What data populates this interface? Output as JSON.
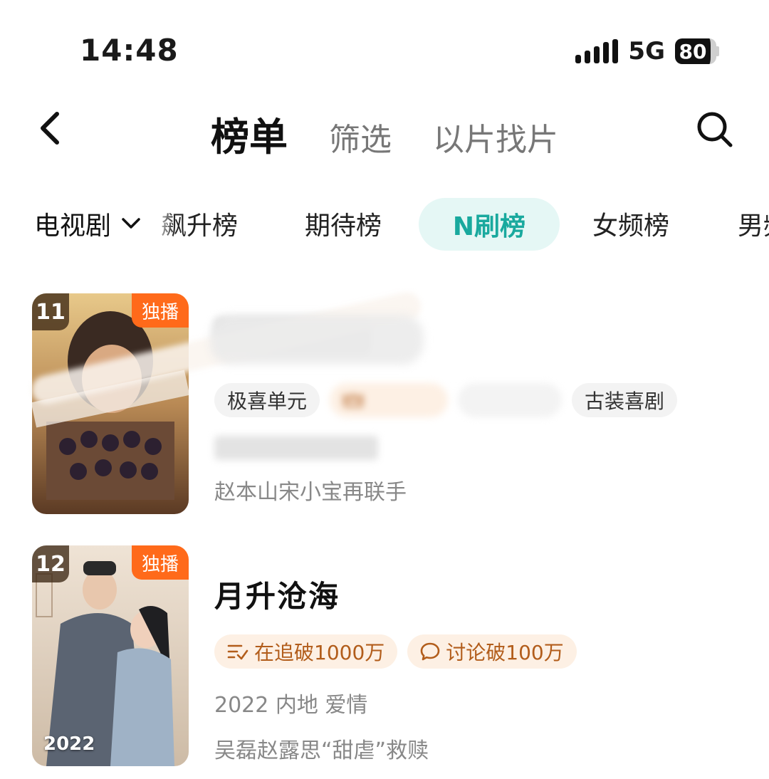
{
  "status_bar": {
    "time": "14:48",
    "network": "5G",
    "battery": "80"
  },
  "nav": {
    "tabs": [
      {
        "label": "榜单",
        "active": true
      },
      {
        "label": "筛选",
        "active": false
      },
      {
        "label": "以片找片",
        "active": false
      }
    ]
  },
  "categories": {
    "dropdown_label": "电视剧",
    "rank_tabs": [
      "飙升榜",
      "期待榜",
      "N刷榜",
      "女频榜",
      "男频榜"
    ],
    "active_index": 2
  },
  "items": [
    {
      "rank": "11",
      "badge": "独播",
      "title": "",
      "tags": [
        {
          "label": "极喜单元",
          "style": "plain",
          "icon": ""
        },
        {
          "label": "",
          "style": "hot",
          "icon": "crown-icon"
        },
        {
          "label": "",
          "style": "plain",
          "icon": ""
        },
        {
          "label": "古装喜剧",
          "style": "plain",
          "icon": ""
        }
      ],
      "meta": "",
      "description": "赵本山宋小宝再联手",
      "year": ""
    },
    {
      "rank": "12",
      "badge": "独播",
      "title": "月升沧海",
      "tags": [
        {
          "label": "在追破1000万",
          "style": "hot",
          "icon": "follow-list-icon"
        },
        {
          "label": "讨论破100万",
          "style": "hot",
          "icon": "chat-bubble-icon"
        }
      ],
      "meta": "2022 内地 爱情",
      "description": "吴磊赵露思“甜虐”救赎",
      "year": "2022"
    }
  ],
  "colors": {
    "accent_teal": "#19a99e",
    "accent_bg": "#e5f7f5",
    "exclusive_orange": "#ff6a1a",
    "hot_tag_bg": "#fdf0e4",
    "hot_tag_text": "#b25d1b"
  }
}
